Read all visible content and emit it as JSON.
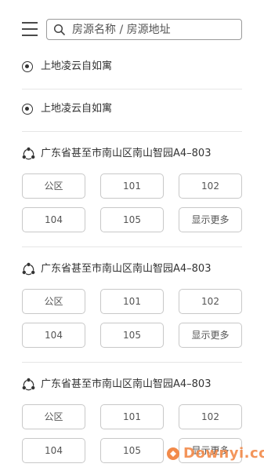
{
  "search": {
    "placeholder": "房源名称 / 房源地址"
  },
  "radio_items": [
    {
      "label": "上地凌云自如寓"
    },
    {
      "label": "上地凌云自如寓"
    }
  ],
  "sections": [
    {
      "title": "广东省甚至市南山区南山智园A4–803",
      "rooms": [
        "公区",
        "101",
        "102",
        "104",
        "105",
        "显示更多"
      ]
    },
    {
      "title": "广东省甚至市南山区南山智园A4–803",
      "rooms": [
        "公区",
        "101",
        "102",
        "104",
        "105",
        "显示更多"
      ]
    },
    {
      "title": "广东省甚至市南山区南山智园A4–803",
      "rooms": [
        "公区",
        "101",
        "102",
        "104",
        "105",
        "显示更多"
      ]
    }
  ],
  "watermark": {
    "text": "Downyi.com"
  },
  "colors": {
    "watermark": "#f28a4a",
    "border": "#c8c8c8",
    "divider": "#e6e6e6"
  }
}
